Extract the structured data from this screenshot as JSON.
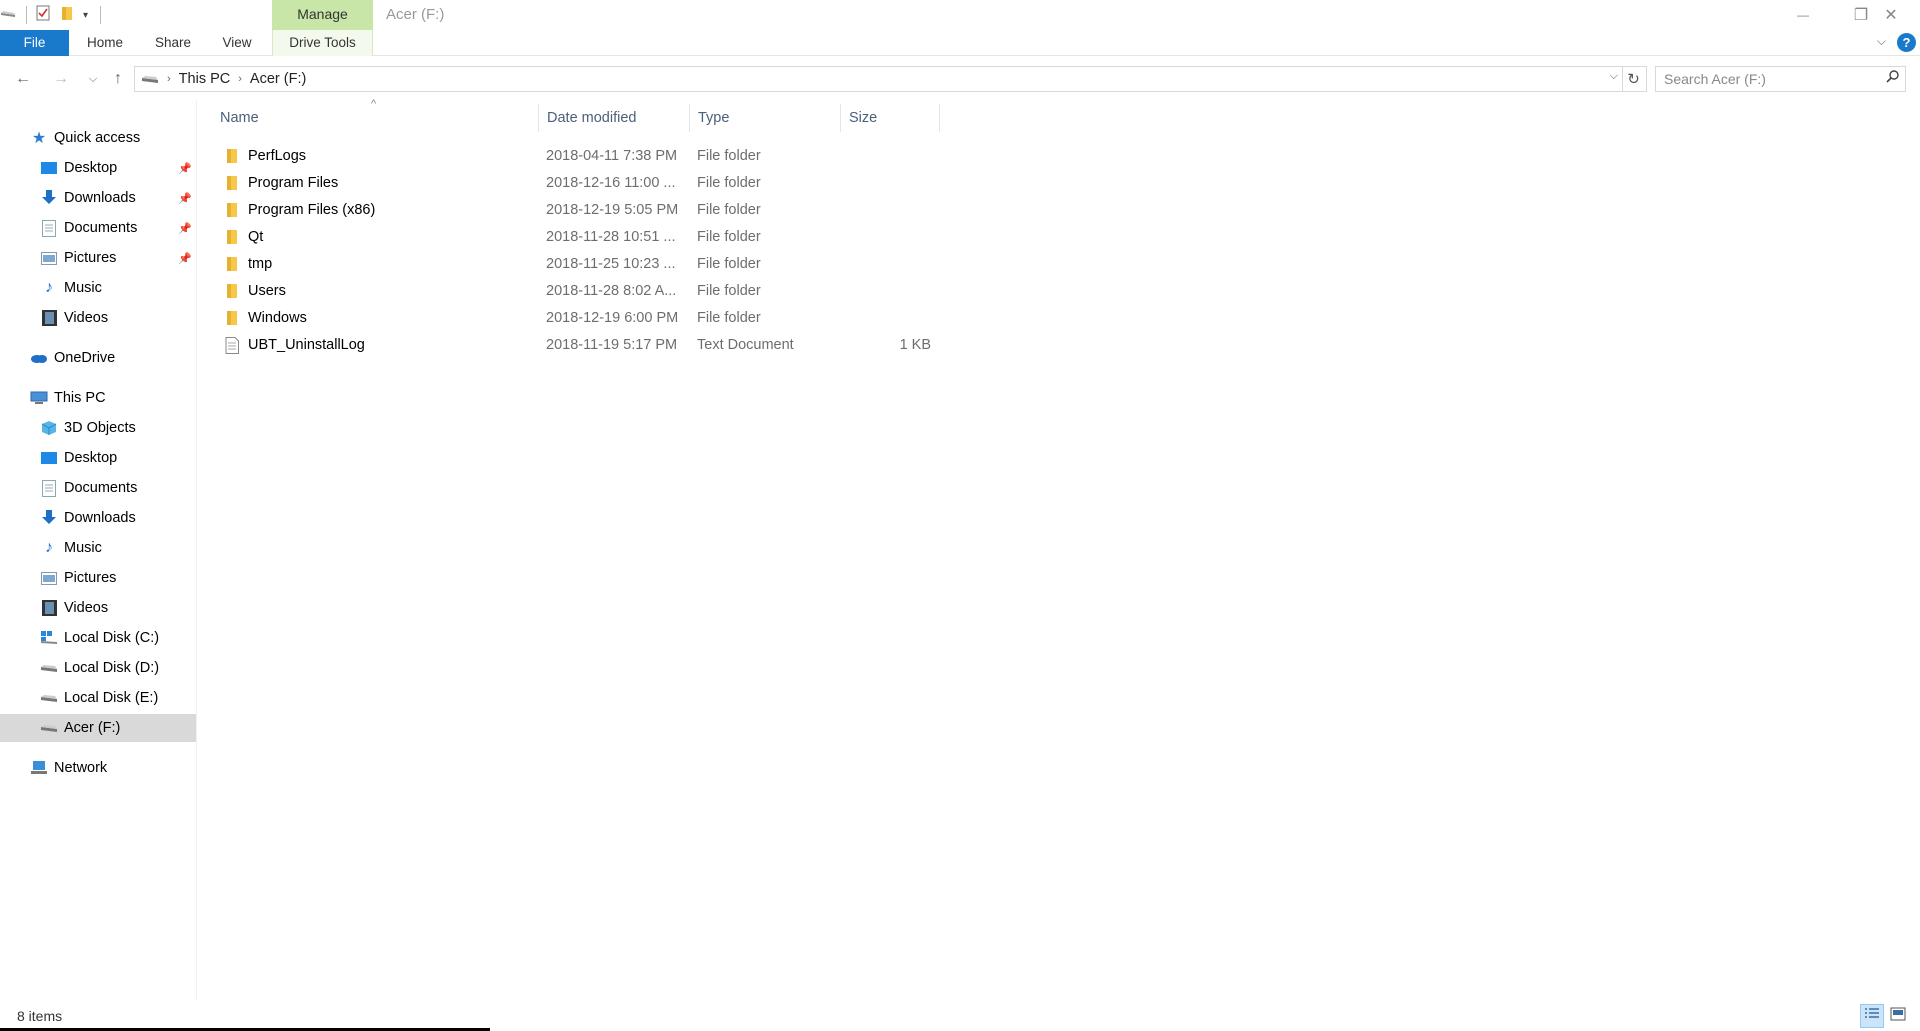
{
  "window": {
    "title": "Acer (F:)",
    "manage_tab": "Manage",
    "minimize": "—",
    "restore": "❐",
    "close": "✕"
  },
  "ribbon": {
    "tabs": [
      "File",
      "Home",
      "Share",
      "View",
      "Drive Tools"
    ],
    "help": "?"
  },
  "address": {
    "breadcrumbs": [
      "This PC",
      "Acer (F:)"
    ],
    "search_placeholder": "Search Acer (F:)"
  },
  "navigation": {
    "quick_access": "Quick access",
    "quick_items": [
      "Desktop",
      "Downloads",
      "Documents",
      "Pictures",
      "Music",
      "Videos"
    ],
    "onedrive": "OneDrive",
    "this_pc": "This PC",
    "pc_items": [
      "3D Objects",
      "Desktop",
      "Documents",
      "Downloads",
      "Music",
      "Pictures",
      "Videos",
      "Local Disk (C:)",
      "Local Disk (D:)",
      "Local Disk (E:)",
      "Acer (F:)"
    ],
    "network": "Network",
    "selected": "Acer (F:)"
  },
  "columns": {
    "name": "Name",
    "date": "Date modified",
    "type": "Type",
    "size": "Size"
  },
  "files": [
    {
      "name": "PerfLogs",
      "date": "2018-04-11 7:38 PM",
      "type": "File folder",
      "size": "",
      "kind": "folder"
    },
    {
      "name": "Program Files",
      "date": "2018-12-16 11:00 ...",
      "type": "File folder",
      "size": "",
      "kind": "folder"
    },
    {
      "name": "Program Files (x86)",
      "date": "2018-12-19 5:05 PM",
      "type": "File folder",
      "size": "",
      "kind": "folder"
    },
    {
      "name": "Qt",
      "date": "2018-11-28 10:51 ...",
      "type": "File folder",
      "size": "",
      "kind": "folder"
    },
    {
      "name": "tmp",
      "date": "2018-11-25 10:23 ...",
      "type": "File folder",
      "size": "",
      "kind": "folder"
    },
    {
      "name": "Users",
      "date": "2018-11-28 8:02 A...",
      "type": "File folder",
      "size": "",
      "kind": "folder"
    },
    {
      "name": "Windows",
      "date": "2018-12-19 6:00 PM",
      "type": "File folder",
      "size": "",
      "kind": "folder"
    },
    {
      "name": "UBT_UninstallLog",
      "date": "2018-11-19 5:17 PM",
      "type": "Text Document",
      "size": "1 KB",
      "kind": "text"
    }
  ],
  "status": {
    "items": "8 items"
  },
  "colors": {
    "accent": "#1979ca",
    "manage_tab": "#c8e6a8",
    "selected": "#d9d9d9",
    "header_text": "#4c607a",
    "folder": "#f5c84c"
  }
}
